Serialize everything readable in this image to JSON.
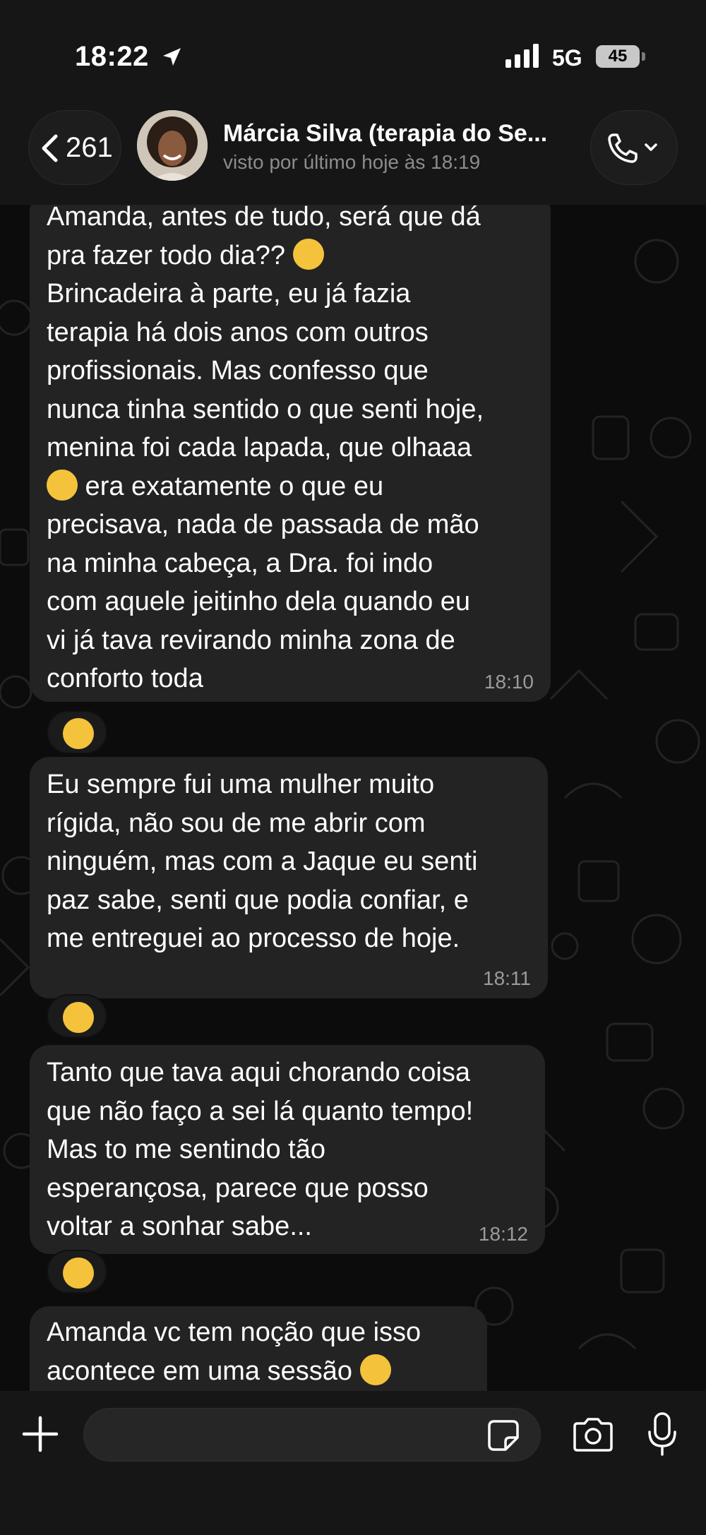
{
  "status_bar": {
    "time": "18:22",
    "network": "5G",
    "battery": "45"
  },
  "header": {
    "back_count": "261",
    "contact_name": "Márcia Silva (terapia do Se...",
    "last_seen": "visto por último hoje às 18:19"
  },
  "messages": [
    {
      "text": "Amanda, antes de tudo, será que dá\npra fazer todo dia??",
      "text_emoji": "rolling-on-floor-laughing",
      "text_b": "\nBrincadeira à parte, eu já fazia\nterapia há dois anos com outros\nprofissionais. Mas confesso que\nnunca tinha sentido o que senti hoje,\nmenina foi cada lapada, que olhaaa",
      "inline_emoji": "face-exhaling",
      "text_c": " era exatamente o que eu\nprecisava, nada de passada de mão\nna minha cabeça, a Dra. foi indo\ncom aquele jeitinho dela quando eu\nvi já tava revirando minha zona de\nconforto toda",
      "time": "18:10",
      "reaction": "smiling-face-with-hearts"
    },
    {
      "text": "Eu sempre fui uma mulher muito\nrígida, não sou de me abrir com\nninguém, mas com a Jaque eu senti\npaz sabe, senti que podia confiar, e\nme entreguei ao processo de hoje.",
      "time": "18:11",
      "reaction": "pleading-face"
    },
    {
      "text": "Tanto que tava aqui chorando coisa\nque não faço a sei lá quanto tempo!\nMas to me sentindo tão\nesperançosa, parece que posso\nvoltar a sonhar sabe...",
      "time": "18:12",
      "reaction": "partying-face"
    },
    {
      "text": "Amanda vc tem noção que isso\nacontece em uma sessão",
      "trailing_emoji": "face-screaming-in-fear"
    }
  ],
  "input": {
    "placeholder": ""
  },
  "colors": {
    "bubble": "#232323",
    "background": "#0c0c0c",
    "bar": "#161616",
    "timestamp": "#9a9a9a"
  }
}
